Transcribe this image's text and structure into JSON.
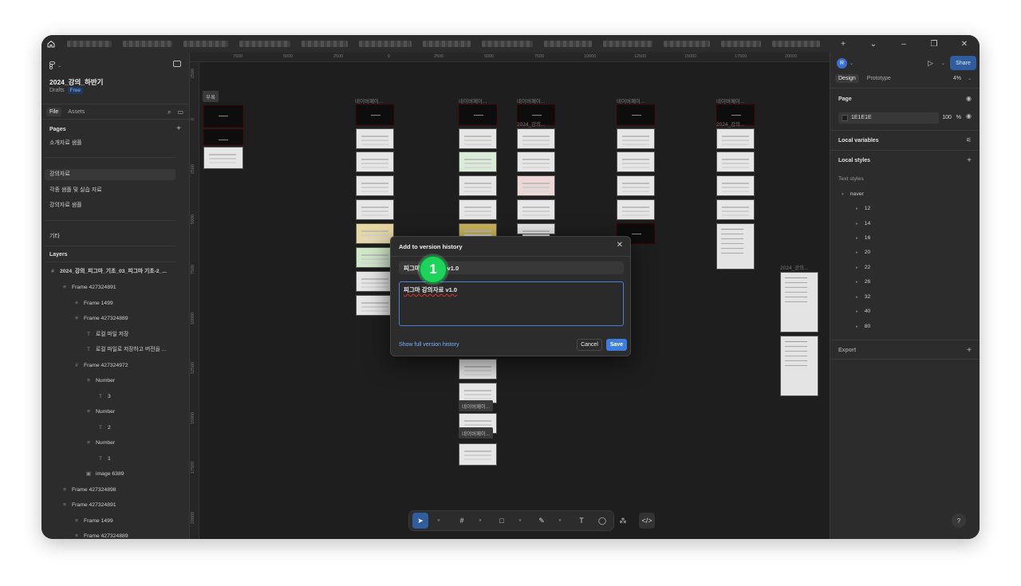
{
  "left_panel": {
    "file_title": "2024_강의_하반기",
    "drafts": "Drafts",
    "free_badge": "Free",
    "tabs": {
      "file": "File",
      "assets": "Assets"
    },
    "pages_heading": "Pages",
    "pages": [
      "소개자료 샘플",
      "강의자료",
      "각종 샘플 및 실습 자료",
      "강의자료 샘플",
      "기타"
    ],
    "layers_heading": "Layers",
    "layers": [
      "2024_강의_피그마_기초_03_피그마 기초-2_...",
      "Frame 427324891",
      "Frame 1499",
      "Frame 427324889",
      "로컬 파일 저장",
      "로컬 파일로 저장하고 버전을 ...",
      "Frame 427324972",
      "Number",
      "3",
      "Number",
      "2",
      "Number",
      "1",
      "image 6389",
      "Frame 427324898",
      "Frame 427324891",
      "Frame 1499",
      "Frame 427324889"
    ]
  },
  "canvas": {
    "ruler_top": [
      "7500",
      "5000",
      "2500",
      "0",
      "2500",
      "5000",
      "7500",
      "10000",
      "12500",
      "15000",
      "17500",
      "20000"
    ],
    "ruler_left": [
      "2500",
      "0",
      "2500",
      "5000",
      "7500",
      "10000",
      "12500",
      "15000",
      "17500",
      "20000"
    ],
    "labels": {
      "left_frame": "부록",
      "col1": "네이버페이...",
      "col2": "네이버페이...",
      "col3": "네이버페이...",
      "col3b": "2024_강의...",
      "col4": "네이버페이...",
      "col5": "네이버페이...",
      "col5b": "2024_강의...",
      "col6": "2024_강의...",
      "chip1": "네이버페이...",
      "chip2": "네이버페이..."
    }
  },
  "dialog": {
    "title": "Add to version history",
    "title_value": "피그마 강의자료_v1.0",
    "description_value": "피그마 강의자료 v1.0",
    "show_history": "Show full version history",
    "cancel": "Cancel",
    "save": "Save"
  },
  "step_badge": "1",
  "right_panel": {
    "avatar": "R",
    "share": "Share",
    "tabs": {
      "design": "Design",
      "prototype": "Prototype"
    },
    "zoom": "4%",
    "page_heading": "Page",
    "page_color": "1E1E1E",
    "page_opacity": "100",
    "percent": "%",
    "local_variables": "Local variables",
    "local_styles": "Local styles",
    "text_styles": "Text styles",
    "style_group": "naver",
    "style_sizes": [
      "12",
      "14",
      "16",
      "20",
      "22",
      "26",
      "32",
      "40",
      "80"
    ],
    "export": "Export",
    "help": "?"
  }
}
